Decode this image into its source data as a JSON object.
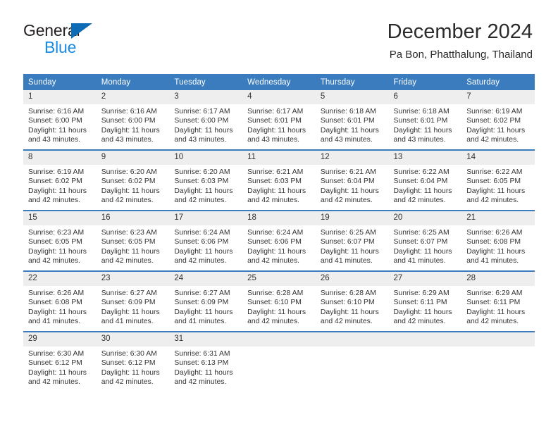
{
  "brand": {
    "name_part1": "General",
    "name_part2": "Blue",
    "logo_icon": "triangle-logo-icon",
    "accent_color": "#0d6cb5",
    "secondary_color": "#1b8ae0"
  },
  "header": {
    "title": "December 2024",
    "subtitle": "Pa Bon, Phatthalung, Thailand"
  },
  "calendar": {
    "header_bg_color": "#3a7cbe",
    "daynum_bg_color": "#eeeeee",
    "weekday_headers": [
      "Sunday",
      "Monday",
      "Tuesday",
      "Wednesday",
      "Thursday",
      "Friday",
      "Saturday"
    ],
    "weeks": [
      [
        {
          "day": "1",
          "sunrise": "Sunrise: 6:16 AM",
          "sunset": "Sunset: 6:00 PM",
          "daylight_line1": "Daylight: 11 hours",
          "daylight_line2": "and 43 minutes."
        },
        {
          "day": "2",
          "sunrise": "Sunrise: 6:16 AM",
          "sunset": "Sunset: 6:00 PM",
          "daylight_line1": "Daylight: 11 hours",
          "daylight_line2": "and 43 minutes."
        },
        {
          "day": "3",
          "sunrise": "Sunrise: 6:17 AM",
          "sunset": "Sunset: 6:00 PM",
          "daylight_line1": "Daylight: 11 hours",
          "daylight_line2": "and 43 minutes."
        },
        {
          "day": "4",
          "sunrise": "Sunrise: 6:17 AM",
          "sunset": "Sunset: 6:01 PM",
          "daylight_line1": "Daylight: 11 hours",
          "daylight_line2": "and 43 minutes."
        },
        {
          "day": "5",
          "sunrise": "Sunrise: 6:18 AM",
          "sunset": "Sunset: 6:01 PM",
          "daylight_line1": "Daylight: 11 hours",
          "daylight_line2": "and 43 minutes."
        },
        {
          "day": "6",
          "sunrise": "Sunrise: 6:18 AM",
          "sunset": "Sunset: 6:01 PM",
          "daylight_line1": "Daylight: 11 hours",
          "daylight_line2": "and 43 minutes."
        },
        {
          "day": "7",
          "sunrise": "Sunrise: 6:19 AM",
          "sunset": "Sunset: 6:02 PM",
          "daylight_line1": "Daylight: 11 hours",
          "daylight_line2": "and 42 minutes."
        }
      ],
      [
        {
          "day": "8",
          "sunrise": "Sunrise: 6:19 AM",
          "sunset": "Sunset: 6:02 PM",
          "daylight_line1": "Daylight: 11 hours",
          "daylight_line2": "and 42 minutes."
        },
        {
          "day": "9",
          "sunrise": "Sunrise: 6:20 AM",
          "sunset": "Sunset: 6:02 PM",
          "daylight_line1": "Daylight: 11 hours",
          "daylight_line2": "and 42 minutes."
        },
        {
          "day": "10",
          "sunrise": "Sunrise: 6:20 AM",
          "sunset": "Sunset: 6:03 PM",
          "daylight_line1": "Daylight: 11 hours",
          "daylight_line2": "and 42 minutes."
        },
        {
          "day": "11",
          "sunrise": "Sunrise: 6:21 AM",
          "sunset": "Sunset: 6:03 PM",
          "daylight_line1": "Daylight: 11 hours",
          "daylight_line2": "and 42 minutes."
        },
        {
          "day": "12",
          "sunrise": "Sunrise: 6:21 AM",
          "sunset": "Sunset: 6:04 PM",
          "daylight_line1": "Daylight: 11 hours",
          "daylight_line2": "and 42 minutes."
        },
        {
          "day": "13",
          "sunrise": "Sunrise: 6:22 AM",
          "sunset": "Sunset: 6:04 PM",
          "daylight_line1": "Daylight: 11 hours",
          "daylight_line2": "and 42 minutes."
        },
        {
          "day": "14",
          "sunrise": "Sunrise: 6:22 AM",
          "sunset": "Sunset: 6:05 PM",
          "daylight_line1": "Daylight: 11 hours",
          "daylight_line2": "and 42 minutes."
        }
      ],
      [
        {
          "day": "15",
          "sunrise": "Sunrise: 6:23 AM",
          "sunset": "Sunset: 6:05 PM",
          "daylight_line1": "Daylight: 11 hours",
          "daylight_line2": "and 42 minutes."
        },
        {
          "day": "16",
          "sunrise": "Sunrise: 6:23 AM",
          "sunset": "Sunset: 6:05 PM",
          "daylight_line1": "Daylight: 11 hours",
          "daylight_line2": "and 42 minutes."
        },
        {
          "day": "17",
          "sunrise": "Sunrise: 6:24 AM",
          "sunset": "Sunset: 6:06 PM",
          "daylight_line1": "Daylight: 11 hours",
          "daylight_line2": "and 42 minutes."
        },
        {
          "day": "18",
          "sunrise": "Sunrise: 6:24 AM",
          "sunset": "Sunset: 6:06 PM",
          "daylight_line1": "Daylight: 11 hours",
          "daylight_line2": "and 42 minutes."
        },
        {
          "day": "19",
          "sunrise": "Sunrise: 6:25 AM",
          "sunset": "Sunset: 6:07 PM",
          "daylight_line1": "Daylight: 11 hours",
          "daylight_line2": "and 41 minutes."
        },
        {
          "day": "20",
          "sunrise": "Sunrise: 6:25 AM",
          "sunset": "Sunset: 6:07 PM",
          "daylight_line1": "Daylight: 11 hours",
          "daylight_line2": "and 41 minutes."
        },
        {
          "day": "21",
          "sunrise": "Sunrise: 6:26 AM",
          "sunset": "Sunset: 6:08 PM",
          "daylight_line1": "Daylight: 11 hours",
          "daylight_line2": "and 41 minutes."
        }
      ],
      [
        {
          "day": "22",
          "sunrise": "Sunrise: 6:26 AM",
          "sunset": "Sunset: 6:08 PM",
          "daylight_line1": "Daylight: 11 hours",
          "daylight_line2": "and 41 minutes."
        },
        {
          "day": "23",
          "sunrise": "Sunrise: 6:27 AM",
          "sunset": "Sunset: 6:09 PM",
          "daylight_line1": "Daylight: 11 hours",
          "daylight_line2": "and 41 minutes."
        },
        {
          "day": "24",
          "sunrise": "Sunrise: 6:27 AM",
          "sunset": "Sunset: 6:09 PM",
          "daylight_line1": "Daylight: 11 hours",
          "daylight_line2": "and 41 minutes."
        },
        {
          "day": "25",
          "sunrise": "Sunrise: 6:28 AM",
          "sunset": "Sunset: 6:10 PM",
          "daylight_line1": "Daylight: 11 hours",
          "daylight_line2": "and 42 minutes."
        },
        {
          "day": "26",
          "sunrise": "Sunrise: 6:28 AM",
          "sunset": "Sunset: 6:10 PM",
          "daylight_line1": "Daylight: 11 hours",
          "daylight_line2": "and 42 minutes."
        },
        {
          "day": "27",
          "sunrise": "Sunrise: 6:29 AM",
          "sunset": "Sunset: 6:11 PM",
          "daylight_line1": "Daylight: 11 hours",
          "daylight_line2": "and 42 minutes."
        },
        {
          "day": "28",
          "sunrise": "Sunrise: 6:29 AM",
          "sunset": "Sunset: 6:11 PM",
          "daylight_line1": "Daylight: 11 hours",
          "daylight_line2": "and 42 minutes."
        }
      ],
      [
        {
          "day": "29",
          "sunrise": "Sunrise: 6:30 AM",
          "sunset": "Sunset: 6:12 PM",
          "daylight_line1": "Daylight: 11 hours",
          "daylight_line2": "and 42 minutes."
        },
        {
          "day": "30",
          "sunrise": "Sunrise: 6:30 AM",
          "sunset": "Sunset: 6:12 PM",
          "daylight_line1": "Daylight: 11 hours",
          "daylight_line2": "and 42 minutes."
        },
        {
          "day": "31",
          "sunrise": "Sunrise: 6:31 AM",
          "sunset": "Sunset: 6:13 PM",
          "daylight_line1": "Daylight: 11 hours",
          "daylight_line2": "and 42 minutes."
        },
        {
          "day": "",
          "sunrise": "",
          "sunset": "",
          "daylight_line1": "",
          "daylight_line2": ""
        },
        {
          "day": "",
          "sunrise": "",
          "sunset": "",
          "daylight_line1": "",
          "daylight_line2": ""
        },
        {
          "day": "",
          "sunrise": "",
          "sunset": "",
          "daylight_line1": "",
          "daylight_line2": ""
        },
        {
          "day": "",
          "sunrise": "",
          "sunset": "",
          "daylight_line1": "",
          "daylight_line2": ""
        }
      ]
    ]
  }
}
